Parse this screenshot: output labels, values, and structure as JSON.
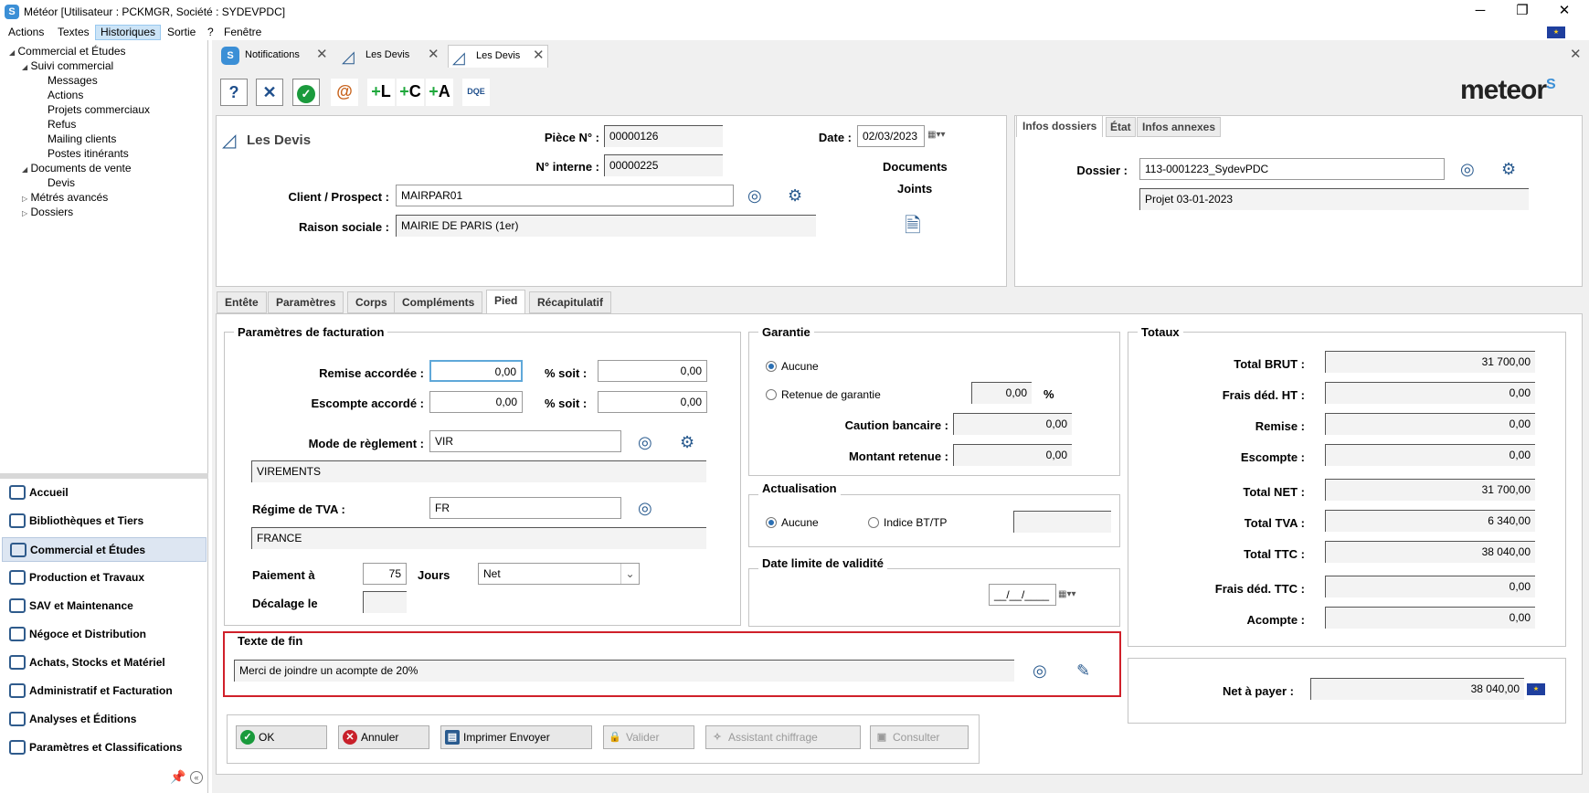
{
  "window": {
    "title": "Météor [Utilisateur : PCKMGR, Société : SYDEVPDC]",
    "min": "─",
    "restore": "❐",
    "close": "✕"
  },
  "menu": [
    "Actions",
    "Textes",
    "Historiques",
    "Sortie",
    "?",
    "Fenêtre"
  ],
  "tree": {
    "root": "Commercial et Études",
    "suivi": "Suivi commercial",
    "suivi_items": [
      "Messages",
      "Actions",
      "Projets commerciaux",
      "Refus",
      "Mailing clients",
      "Postes itinérants"
    ],
    "docs": "Documents de vente",
    "docs_items": [
      "Devis"
    ],
    "metres": "Métrés avancés",
    "dossiers": "Dossiers"
  },
  "nav": [
    "Accueil",
    "Bibliothèques et Tiers",
    "Commercial et Études",
    "Production et Travaux",
    "SAV et Maintenance",
    "Négoce et Distribution",
    "Achats, Stocks et Matériel",
    "Administratif et Facturation",
    "Analyses et Éditions",
    "Paramètres et Classifications"
  ],
  "doc_tabs": [
    "Notifications",
    "Les Devis",
    "Les Devis"
  ],
  "logo": "meteor",
  "header": {
    "title": "Les Devis",
    "piece_label": "Pièce N° :",
    "piece": "00000126",
    "interne_label": "N° interne :",
    "interne": "00000225",
    "date_label": "Date :",
    "date": "02/03/2023",
    "client_label": "Client / Prospect :",
    "client": "MAIRPAR01",
    "raison_label": "Raison sociale :",
    "raison": "MAIRIE DE PARIS (1er)",
    "docs_label1": "Documents",
    "docs_label2": "Joints"
  },
  "infos": {
    "tabs": [
      "Infos dossiers",
      "État",
      "Infos annexes"
    ],
    "dossier_label": "Dossier :",
    "dossier": "113-0001223_SydevPDC",
    "projet": "Projet 03-01-2023"
  },
  "subtabs": [
    "Entête",
    "Paramètres",
    "Corps",
    "Compléments",
    "Pied",
    "Récapitulatif"
  ],
  "facturation": {
    "legend": "Paramètres de facturation",
    "remise_label": "Remise accordée :",
    "remise": "0,00",
    "pct_soit": "% soit :",
    "remise_soit": "0,00",
    "escompte_label": "Escompte accordé :",
    "escompte": "0,00",
    "escompte_soit": "0,00",
    "mode_label": "Mode de règlement :",
    "mode": "VIR",
    "mode_desc": "VIREMENTS",
    "tva_label": "Régime de TVA :",
    "tva": "FR",
    "tva_desc": "FRANCE",
    "paiement_label": "Paiement à",
    "paiement": "75",
    "jours": "Jours",
    "net": "Net",
    "decalage_label": "Décalage le"
  },
  "garantie": {
    "legend": "Garantie",
    "aucune": "Aucune",
    "retenue": "Retenue de garantie",
    "retenue_val": "0,00",
    "pct": "%",
    "caution_label": "Caution bancaire :",
    "caution": "0,00",
    "montant_label": "Montant retenue :",
    "montant": "0,00"
  },
  "actualisation": {
    "legend": "Actualisation",
    "aucune": "Aucune",
    "indice": "Indice BT/TP"
  },
  "validite": {
    "legend": "Date limite de validité",
    "date": "__/__/____"
  },
  "totaux": {
    "legend": "Totaux",
    "rows": [
      {
        "label": "Total BRUT :",
        "value": "31 700,00"
      },
      {
        "label": "Frais déd. HT :",
        "value": "0,00"
      },
      {
        "label": "Remise :",
        "value": "0,00"
      },
      {
        "label": "Escompte :",
        "value": "0,00"
      },
      {
        "label": "Total NET :",
        "value": "31 700,00"
      },
      {
        "label": "Total TVA :",
        "value": "6 340,00"
      },
      {
        "label": "Total TTC :",
        "value": "38 040,00"
      },
      {
        "label": "Frais déd. TTC :",
        "value": "0,00"
      },
      {
        "label": "Acompte :",
        "value": "0,00"
      }
    ],
    "net_label": "Net à payer :",
    "net": "38 040,00"
  },
  "texte_fin": {
    "legend": "Texte de fin",
    "value": "Merci de joindre un acompte de 20%"
  },
  "buttons": {
    "ok": "OK",
    "annuler": "Annuler",
    "imprimer": "Imprimer Envoyer",
    "valider": "Valider",
    "assistant": "Assistant chiffrage",
    "consulter": "Consulter"
  },
  "colors": {
    "accent": "#2a5b8f",
    "highlight": "#d0202a"
  }
}
